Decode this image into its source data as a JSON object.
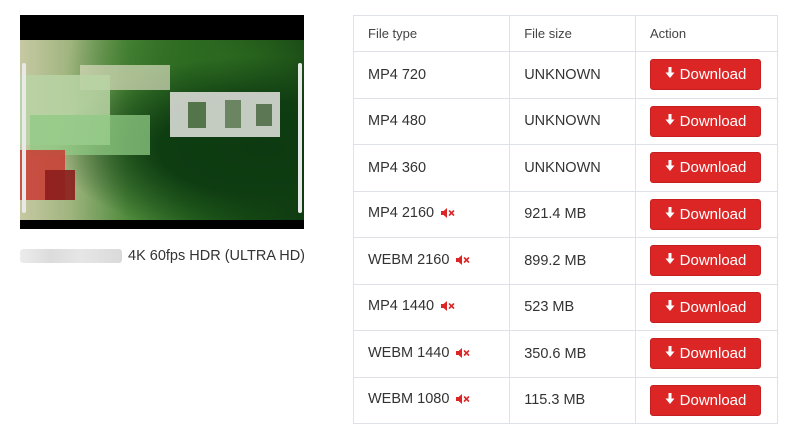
{
  "video": {
    "title": "4K 60fps HDR (ULTRA HD)"
  },
  "table": {
    "headers": {
      "type": "File type",
      "size": "File size",
      "action": "Action"
    },
    "rows": [
      {
        "type": "MP4 720",
        "size": "UNKNOWN",
        "muted": false,
        "button": "Download"
      },
      {
        "type": "MP4 480",
        "size": "UNKNOWN",
        "muted": false,
        "button": "Download"
      },
      {
        "type": "MP4 360",
        "size": "UNKNOWN",
        "muted": false,
        "button": "Download"
      },
      {
        "type": "MP4 2160",
        "size": "921.4 MB",
        "muted": true,
        "button": "Download"
      },
      {
        "type": "WEBM 2160",
        "size": "899.2 MB",
        "muted": true,
        "button": "Download"
      },
      {
        "type": "MP4 1440",
        "size": "523 MB",
        "muted": true,
        "button": "Download"
      },
      {
        "type": "WEBM 1440",
        "size": "350.6 MB",
        "muted": true,
        "button": "Download"
      },
      {
        "type": "WEBM 1080",
        "size": "115.3 MB",
        "muted": true,
        "button": "Download"
      }
    ]
  },
  "icons": {
    "download": "download-arrow-icon",
    "no_audio": "muted-speaker-icon"
  },
  "colors": {
    "button": "#dc2626",
    "button_text": "#ffffff",
    "border": "#dee2e6",
    "muted_icon": "#dc2626"
  }
}
